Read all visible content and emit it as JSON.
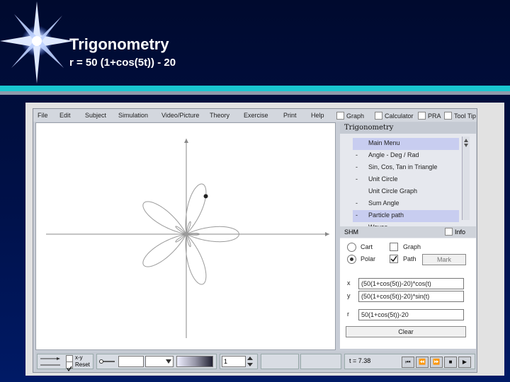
{
  "slide": {
    "title": "Trigonometry",
    "subtitle": "r = 50 (1+cos(5t)) - 20"
  },
  "menubar": {
    "items": [
      "File",
      "Edit",
      "Subject",
      "Simulation",
      "Video/Picture",
      "Theory",
      "Exercise",
      "Print",
      "Help"
    ],
    "checkboxes": [
      "Graph",
      "Calculator",
      "PRA",
      "Tool Tip"
    ]
  },
  "right_panel": {
    "title": "Trigonometry",
    "menu_items": [
      {
        "dash": "",
        "label": "Main Menu"
      },
      {
        "dash": "-",
        "label": "Angle - Deg / Rad"
      },
      {
        "dash": "-",
        "label": "Sin, Cos, Tan in Triangle"
      },
      {
        "dash": "-",
        "label": "Unit Circle"
      },
      {
        "dash": "",
        "label": "Unit Circle Graph"
      },
      {
        "dash": "-",
        "label": "Sum Angle"
      },
      {
        "dash": "-",
        "label": "Particle path"
      },
      {
        "dash": "",
        "label": "Waves"
      }
    ],
    "selected_index": 6
  },
  "shm": {
    "label": "SHM",
    "info_label": "Info",
    "cart_label": "Cart",
    "polar_label": "Polar",
    "graph_label": "Graph",
    "path_label": "Path",
    "mark_label": "Mark",
    "x_label": "x",
    "x_expr": "(50(1+cos(5t))-20)*cos(t)",
    "y_label": "y",
    "y_expr": "(50(1+cos(5t))-20)*sin(t)",
    "r_label": "r",
    "r_expr": "50(1+cos(5t))-20",
    "clear_label": "Clear",
    "polar_selected": true,
    "path_checked": true
  },
  "bottom": {
    "xy_label": "x-y",
    "reset_label": "Reset",
    "reset_checked": true,
    "speed_value": "1",
    "time_readout": "t = 7.38"
  }
}
